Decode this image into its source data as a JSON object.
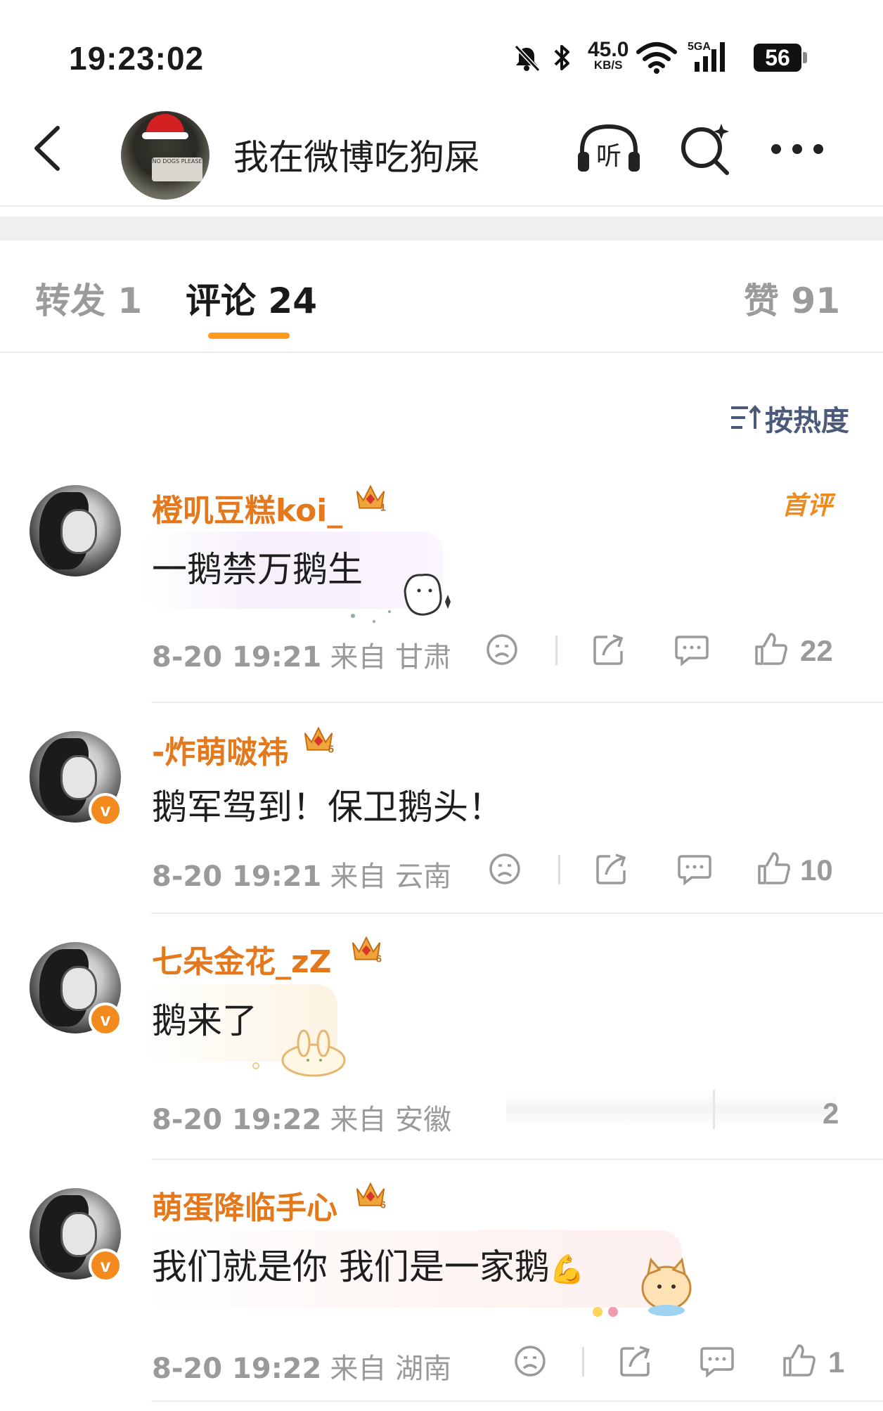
{
  "status_bar": {
    "time": "19:23:02",
    "net_speed": "45.0",
    "net_unit": "KB/S",
    "signal_label": "5GA",
    "battery": "56"
  },
  "nav": {
    "title": "我在微博吃狗屎",
    "avatar_sign_text": "NO DOGS PLEASE"
  },
  "tabs": {
    "forward": "转发 1",
    "comment": "评论 24",
    "like": "赞 91"
  },
  "sort_label": "按热度",
  "first_comment_badge": "首评",
  "comments": [
    {
      "user": "橙叽豆糕koi_",
      "crown_level": "1",
      "verified": false,
      "text": "一鹅禁万鹅生",
      "time": "8-20 19:21",
      "location": "来自 甘肃",
      "likes": "22",
      "first": true
    },
    {
      "user": "-炸萌啵祎",
      "crown_level": "5",
      "verified": true,
      "text": "鹅军驾到！保卫鹅头！",
      "time": "8-20 19:21",
      "location": "来自 云南",
      "likes": "10"
    },
    {
      "user": "七朵金花_zZ",
      "crown_level": "6",
      "verified": true,
      "text": "鹅来了",
      "time": "8-20 19:22",
      "location": "来自 安徽",
      "likes": "2"
    },
    {
      "user": "萌蛋降临手心",
      "crown_level": "6",
      "verified": true,
      "text": "我们就是你 我们是一家鹅",
      "time": "8-20 19:22",
      "location": "来自 湖南",
      "likes": "1"
    }
  ],
  "colors": {
    "accent": "#ff9a1f",
    "username": "#e3791c",
    "meta": "#9a9a9a",
    "sort": "#4a5a78"
  }
}
